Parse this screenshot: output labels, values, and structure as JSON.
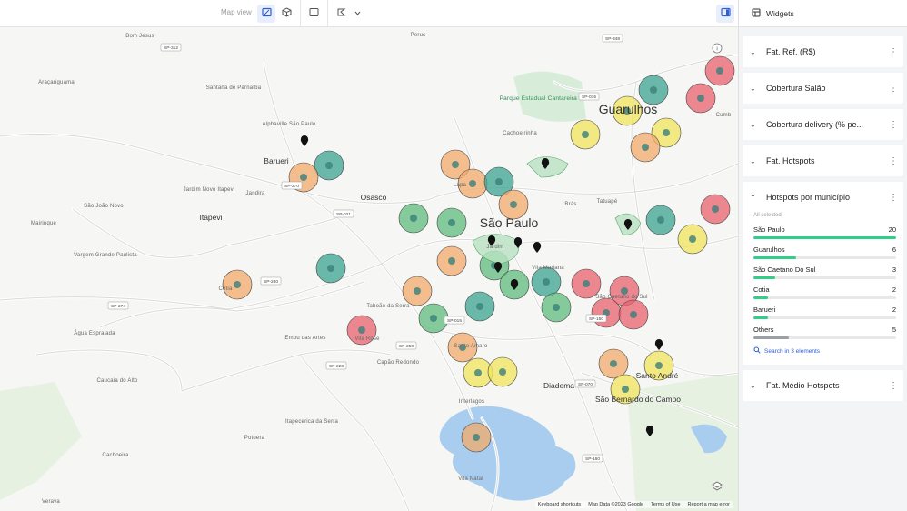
{
  "toolbar": {
    "map_view_label": "Map view"
  },
  "panel": {
    "title": "Widgets"
  },
  "widgets": [
    {
      "title": "Fat. Ref. (R$)"
    },
    {
      "title": "Cobertura Salão"
    },
    {
      "title": "Cobertura delivery (% pe..."
    },
    {
      "title": "Fat. Hotspots"
    }
  ],
  "hotspots_widget": {
    "title": "Hotspots por município",
    "all_selected": "All selected",
    "max": 20,
    "categories": [
      {
        "name": "São Paulo",
        "value": 20
      },
      {
        "name": "Guarulhos",
        "value": 6
      },
      {
        "name": "São Caetano Do Sul",
        "value": 3
      },
      {
        "name": "Cotia",
        "value": 2
      },
      {
        "name": "Barueri",
        "value": 2
      },
      {
        "name": "Others",
        "value": 5
      }
    ],
    "search_label": "Search in 3 elements",
    "bar_color": "#2fcf88",
    "others_color": "#9aa0a6"
  },
  "last_widget": {
    "title": "Fat. Médio Hotspots"
  },
  "map": {
    "places": [
      {
        "text": "São Paulo",
        "size": "large"
      },
      {
        "text": "Guarulhos",
        "size": "large"
      },
      {
        "text": "Osasco",
        "size": "medium"
      },
      {
        "text": "Barueri",
        "size": "medium"
      },
      {
        "text": "Itapevi",
        "size": "medium"
      },
      {
        "text": "Diadema",
        "size": "medium"
      },
      {
        "text": "Santo André",
        "size": "medium"
      },
      {
        "text": "São Bernardo do Campo",
        "size": "medium"
      },
      {
        "text": "Cotia",
        "size": "small"
      },
      {
        "text": "Taboão da Serra",
        "size": "small"
      },
      {
        "text": "Embu das Artes",
        "size": "small"
      },
      {
        "text": "Cachoeirinha",
        "size": "small"
      },
      {
        "text": "Alphaville São Paulo",
        "size": "small"
      },
      {
        "text": "Santana de Parnaíba",
        "size": "small"
      },
      {
        "text": "Jandira",
        "size": "small"
      },
      {
        "text": "Araçariguama",
        "size": "small"
      },
      {
        "text": "Mairinque",
        "size": "small"
      },
      {
        "text": "São João Novo",
        "size": "small"
      },
      {
        "text": "Vargem Grande Paulista",
        "size": "small"
      },
      {
        "text": "Itapecerica da Serra",
        "size": "small"
      },
      {
        "text": "Potuera",
        "size": "small"
      },
      {
        "text": "Cachoeira",
        "size": "small"
      },
      {
        "text": "Caucaia do Alto",
        "size": "small"
      },
      {
        "text": "Água Espraiada",
        "size": "small"
      },
      {
        "text": "Verava",
        "size": "small"
      },
      {
        "text": "Tatuapé",
        "size": "small"
      },
      {
        "text": "Brás",
        "size": "small"
      },
      {
        "text": "Lapa",
        "size": "small"
      },
      {
        "text": "Vila Mariana",
        "size": "small"
      },
      {
        "text": "Santo Amaro",
        "size": "small"
      },
      {
        "text": "Capão Redondo",
        "size": "small"
      },
      {
        "text": "Interlagos",
        "size": "small"
      },
      {
        "text": "Vila Natal",
        "size": "small"
      },
      {
        "text": "Perus",
        "size": "small"
      },
      {
        "text": "Cumb",
        "size": "small"
      },
      {
        "text": "Parque Estadual Cantareira Núcleo",
        "size": "park"
      },
      {
        "text": "Bom Jesus",
        "size": "small"
      },
      {
        "text": "Jardim",
        "size": "small"
      },
      {
        "text": "Jardim Novo Itapevi",
        "size": "small"
      },
      {
        "text": "Vila Rose",
        "size": "small"
      },
      {
        "text": "São Caetano do Sul",
        "size": "small"
      }
    ],
    "road_shields": [
      "SP-312",
      "SP-021",
      "SP-280",
      "SP-270",
      "SP-274",
      "SP-250",
      "SP-228",
      "SP-150",
      "SP-160",
      "SP-070",
      "SP-015",
      "SP-348",
      "SP-036"
    ],
    "attribution": [
      "Keyboard shortcuts",
      "Map Data ©2023 Google",
      "Terms of Use",
      "Report a map error"
    ],
    "colors": {
      "green": "#5dbb7c",
      "teal": "#3aa392",
      "orange": "#f2a96b",
      "yellow": "#f2e45e",
      "red": "#e8616f",
      "lightyellow": "#f4ea77"
    }
  }
}
